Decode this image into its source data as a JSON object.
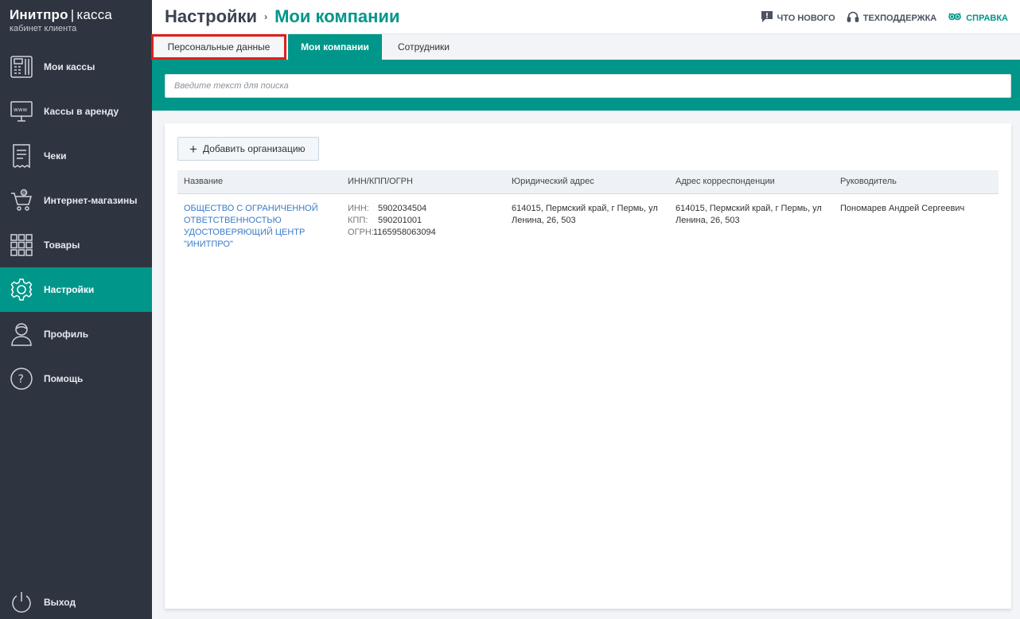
{
  "brand": {
    "name_bold": "Инитпро",
    "name_sep": "|",
    "name_light": "касса",
    "subtitle": "кабинет клиента"
  },
  "sidebar": {
    "items": [
      {
        "label": "Мои кассы",
        "icon": "cash-register-icon"
      },
      {
        "label": "Кассы в аренду",
        "icon": "www-monitor-icon"
      },
      {
        "label": "Чеки",
        "icon": "receipt-icon"
      },
      {
        "label": "Интернет-магазины",
        "icon": "cart-icon"
      },
      {
        "label": "Товары",
        "icon": "grid-icon"
      },
      {
        "label": "Настройки",
        "icon": "gear-icon",
        "active": true
      },
      {
        "label": "Профиль",
        "icon": "user-icon"
      },
      {
        "label": "Помощь",
        "icon": "help-icon"
      }
    ],
    "logout": {
      "label": "Выход",
      "icon": "power-icon"
    }
  },
  "header": {
    "breadcrumb_root": "Настройки",
    "breadcrumb_sep": "›",
    "breadcrumb_current": "Мои компании",
    "links": [
      {
        "label": "ЧТО НОВОГО",
        "icon": "news-icon"
      },
      {
        "label": "ТЕХПОДДЕРЖКА",
        "icon": "headset-icon"
      },
      {
        "label": "СПРАВКА",
        "icon": "owl-icon"
      }
    ]
  },
  "tabs": [
    {
      "label": "Персональные данные",
      "highlighted": true
    },
    {
      "label": "Мои компании",
      "active": true
    },
    {
      "label": "Сотрудники"
    }
  ],
  "search": {
    "placeholder": "Введите текст для поиска",
    "value": ""
  },
  "content": {
    "add_button": "Добавить организацию",
    "columns": [
      "Название",
      "ИНН/КПП/ОГРН",
      "Юридический адрес",
      "Адрес корреспонденции",
      "Руководитель"
    ],
    "rows": [
      {
        "name": "ОБЩЕСТВО С ОГРАНИЧЕННОЙ ОТВЕТСТВЕННОСТЬЮ УДОСТОВЕРЯЮЩИЙ ЦЕНТР \"ИНИТПРО\"",
        "inn_label": "ИНН:",
        "inn": "5902034504",
        "kpp_label": "КПП:",
        "kpp": "590201001",
        "ogrn_label": "ОГРН:",
        "ogrn": "1165958063094",
        "legal_address": "614015, Пермский край, г Пермь, ул Ленина, 26, 503",
        "postal_address": "614015, Пермский край, г Пермь, ул Ленина, 26, 503",
        "director": "Пономарев Андрей Сергеевич"
      }
    ]
  },
  "colors": {
    "accent": "#00968a",
    "sidebar_bg": "#2e3440",
    "highlight": "#e0201c",
    "link": "#3a7bc8"
  }
}
